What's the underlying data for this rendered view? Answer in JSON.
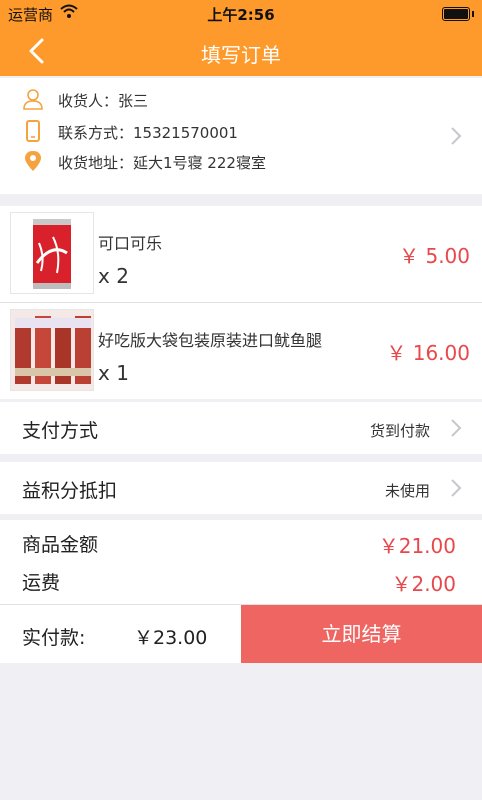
{
  "status_bar": {
    "carrier": "运营商",
    "time": "上午2:56"
  },
  "nav": {
    "title": "填写订单",
    "back_icon": "chevron-left-icon"
  },
  "address": {
    "receiver": "收货人：张三",
    "contact": "联系方式：15321570001",
    "location": "收货地址：延大1号寝 222寝室"
  },
  "goods": [
    {
      "name": "可口可乐",
      "qty": "x 2",
      "price": "￥ 5.00"
    },
    {
      "name": "好吃版大袋包装原装进口鱿鱼腿",
      "qty": "x 1",
      "price": "￥ 16.00"
    }
  ],
  "payment": {
    "label": "支付方式",
    "value": "货到付款"
  },
  "points": {
    "label": "益积分抵扣",
    "value": "未使用"
  },
  "summary": {
    "goods_amount_label": "商品金额",
    "goods_amount_value": "￥21.00",
    "shipping_label": "运费",
    "shipping_value": "￥2.00"
  },
  "checkout": {
    "label": "实付款:",
    "total": "￥23.00",
    "button": "立即结算"
  },
  "colors": {
    "accent": "#fd9a2b",
    "price": "#e8484b",
    "button": "#ee6562"
  }
}
